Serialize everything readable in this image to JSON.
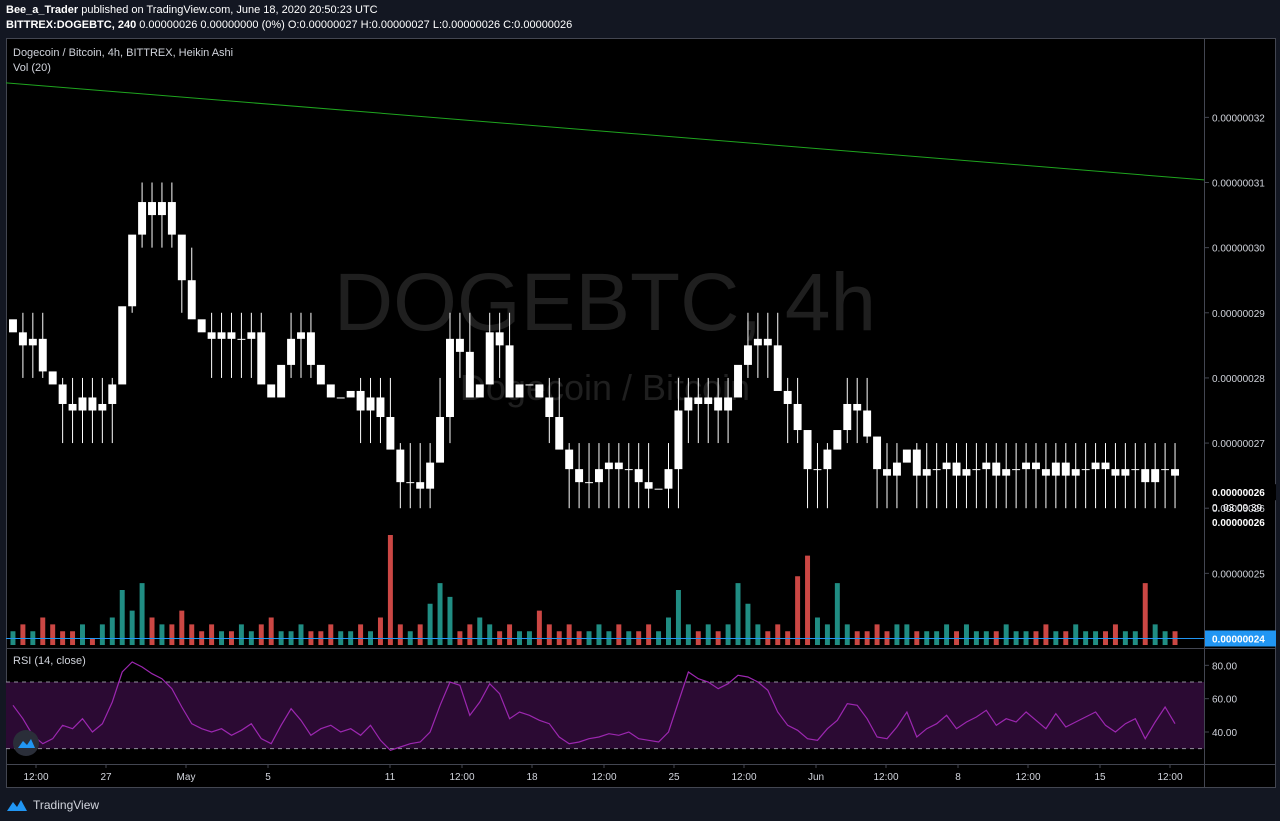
{
  "header": {
    "publisher_line_user": "Bee_a_Trader",
    "publisher_line_rest": " published on TradingView.com, June 18, 2020 20:50:23 UTC",
    "symbol": "BITTREX:DOGEBTC, 240",
    "ohlc": " 0.00000026 0.00000000 (0%) O:0.00000027 H:0.00000027 L:0.00000026 C:0.00000026"
  },
  "pane_labels": {
    "title": "Dogecoin / Bitcoin, 4h, BITTREX, Heikin Ashi",
    "volume": "Vol (20)",
    "rsi": "RSI (14, close)"
  },
  "watermark": {
    "main": "DOGEBTC, 4h",
    "sub": "Dogecoin / Bitcoin"
  },
  "footer": {
    "brand": "TradingView"
  },
  "colors": {
    "background": "#131722",
    "chart_bg": "#000000",
    "candle": "#ffffff",
    "trendline": "#1fa51f",
    "volume_up": "#26a69a",
    "volume_down": "#ef5350",
    "rsi_line": "#9c27b0",
    "rsi_band": "#2b0a33",
    "price_tag": "#2196f3",
    "horizontal_line": "#2196f3"
  },
  "chart_data": [
    {
      "type": "candlestick",
      "style": "Heikin Ashi",
      "symbol": "DOGEBTC",
      "y_ticks": [
        "0.00000032",
        "0.00000031",
        "0.00000030",
        "0.00000029",
        "0.00000028",
        "0.00000027",
        "0.00000026",
        "0.00000025",
        "0.00000024"
      ],
      "price_labels": {
        "last": "0.00000026",
        "countdown": "0. 03:09:39",
        "prev": "0.00000026",
        "line": "0.00000024"
      },
      "ylim": [
        2.39e-07,
        3.285e-07
      ],
      "trendline": {
        "start": 3.253e-07,
        "end": 3.104e-07
      },
      "x_ticks": [
        "12:00",
        "27",
        "May",
        "5",
        "11",
        "12:00",
        "18",
        "12:00",
        "25",
        "12:00",
        "Jun",
        "12:00",
        "8",
        "12:00",
        "15",
        "12:00"
      ],
      "closes": [
        2.87e-07,
        2.85e-07,
        2.86e-07,
        2.81e-07,
        2.79e-07,
        2.76e-07,
        2.75e-07,
        2.77e-07,
        2.75e-07,
        2.76e-07,
        2.79e-07,
        2.91e-07,
        3.02e-07,
        3.07e-07,
        3.05e-07,
        3.07e-07,
        3.02e-07,
        2.95e-07,
        2.89e-07,
        2.87e-07,
        2.86e-07,
        2.87e-07,
        2.86e-07,
        2.86e-07,
        2.87e-07,
        2.79e-07,
        2.77e-07,
        2.82e-07,
        2.86e-07,
        2.87e-07,
        2.82e-07,
        2.79e-07,
        2.77e-07,
        2.77e-07,
        2.78e-07,
        2.75e-07,
        2.77e-07,
        2.74e-07,
        2.69e-07,
        2.64e-07,
        2.64e-07,
        2.63e-07,
        2.67e-07,
        2.74e-07,
        2.86e-07,
        2.84e-07,
        2.77e-07,
        2.79e-07,
        2.87e-07,
        2.85e-07,
        2.77e-07,
        2.79e-07,
        2.79e-07,
        2.77e-07,
        2.74e-07,
        2.69e-07,
        2.66e-07,
        2.64e-07,
        2.64e-07,
        2.66e-07,
        2.67e-07,
        2.66e-07,
        2.66e-07,
        2.64e-07,
        2.63e-07,
        2.63e-07,
        2.66e-07,
        2.75e-07,
        2.77e-07,
        2.76e-07,
        2.77e-07,
        2.75e-07,
        2.77e-07,
        2.82e-07,
        2.85e-07,
        2.86e-07,
        2.85e-07,
        2.78e-07,
        2.76e-07,
        2.72e-07,
        2.66e-07,
        2.66e-07,
        2.69e-07,
        2.72e-07,
        2.76e-07,
        2.75e-07,
        2.71e-07,
        2.66e-07,
        2.65e-07,
        2.67e-07,
        2.69e-07,
        2.65e-07,
        2.66e-07,
        2.66e-07,
        2.67e-07,
        2.65e-07,
        2.66e-07,
        2.66e-07,
        2.67e-07,
        2.65e-07,
        2.66e-07,
        2.66e-07,
        2.67e-07,
        2.66e-07,
        2.65e-07,
        2.67e-07,
        2.65e-07,
        2.66e-07,
        2.66e-07,
        2.67e-07,
        2.66e-07,
        2.65e-07,
        2.66e-07,
        2.66e-07,
        2.64e-07,
        2.66e-07,
        2.66e-07,
        2.65e-07
      ],
      "volume_relative": [
        2,
        3,
        2,
        4,
        3,
        2,
        2,
        3,
        1,
        3,
        4,
        8,
        5,
        9,
        4,
        3,
        3,
        5,
        3,
        2,
        3,
        2,
        2,
        3,
        2,
        3,
        4,
        2,
        2,
        3,
        2,
        2,
        3,
        2,
        2,
        3,
        2,
        4,
        16,
        3,
        2,
        3,
        6,
        9,
        7,
        2,
        3,
        4,
        3,
        2,
        3,
        2,
        2,
        5,
        3,
        2,
        3,
        2,
        2,
        3,
        2,
        3,
        2,
        2,
        3,
        2,
        4,
        8,
        3,
        2,
        3,
        2,
        3,
        9,
        6,
        3,
        2,
        3,
        2,
        10,
        13,
        4,
        3,
        9,
        3,
        2,
        2,
        3,
        2,
        3,
        3,
        2,
        2,
        2,
        3,
        2,
        3,
        2,
        2,
        2,
        3,
        2,
        2,
        2,
        3,
        2,
        2,
        3,
        2,
        2,
        2,
        3,
        2,
        2,
        9,
        3,
        2,
        2
      ]
    },
    {
      "type": "line",
      "name": "RSI (14, close)",
      "y_ticks": [
        "80.00",
        "60.00",
        "40.00"
      ],
      "ylim": [
        22,
        88
      ],
      "bands": [
        70,
        30
      ],
      "values": [
        56,
        48,
        38,
        33,
        36,
        44,
        42,
        48,
        40,
        45,
        58,
        76,
        82,
        79,
        75,
        72,
        66,
        55,
        45,
        42,
        40,
        42,
        38,
        41,
        45,
        36,
        33,
        44,
        54,
        47,
        38,
        42,
        44,
        40,
        42,
        38,
        44,
        35,
        29,
        31,
        33,
        34,
        40,
        56,
        70,
        68,
        50,
        58,
        69,
        63,
        48,
        52,
        50,
        47,
        45,
        37,
        33,
        34,
        36,
        37,
        39,
        38,
        40,
        36,
        35,
        34,
        40,
        58,
        76,
        72,
        70,
        66,
        69,
        74,
        73,
        70,
        65,
        52,
        44,
        41,
        36,
        35,
        42,
        47,
        57,
        56,
        48,
        37,
        36,
        43,
        52,
        37,
        42,
        45,
        50,
        42,
        46,
        49,
        53,
        44,
        48,
        46,
        52,
        47,
        42,
        51,
        43,
        46,
        49,
        52,
        44,
        40,
        45,
        48,
        36,
        46,
        55,
        45
      ]
    }
  ]
}
